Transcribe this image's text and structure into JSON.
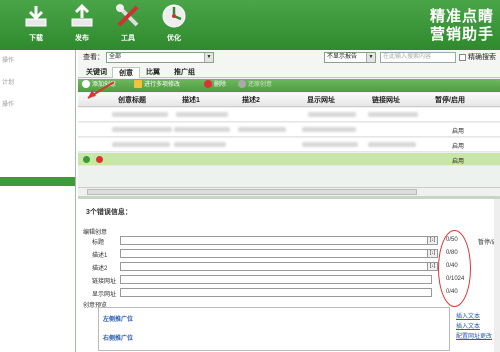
{
  "toolbar_top": {
    "buttons": [
      {
        "label": "下载",
        "icon": "download-icon"
      },
      {
        "label": "发布",
        "icon": "upload-icon"
      },
      {
        "label": "工具",
        "icon": "tools-icon"
      },
      {
        "label": "优化",
        "icon": "optimize-icon"
      }
    ],
    "brand_line1": "精准点睛",
    "brand_line2": "营销助手",
    "color": "#3a9a37"
  },
  "left_panel": {
    "items": [
      "操作",
      "计划",
      "操作"
    ]
  },
  "filter": {
    "view_label": "查看：",
    "view_select": "全部",
    "report_select": "不显示报告",
    "search_placeholder": "在此输入搜索内容",
    "exact_search_label": "精确搜索"
  },
  "tabs": [
    "关键词",
    "创意",
    "比翼",
    "推广组"
  ],
  "active_tab": "创意",
  "actions": {
    "add": "添加创意",
    "batch_edit": "进行多项修改",
    "delete": "删除",
    "restore": "还原创意"
  },
  "table": {
    "columns": [
      "创意标题",
      "描述1",
      "描述2",
      "显示网址",
      "链接网址",
      "暂停/启用"
    ],
    "rows": [
      {
        "status": ""
      },
      {
        "status": "启用"
      },
      {
        "status": "启用"
      }
    ],
    "selected_row_status": "启用"
  },
  "error_panel": {
    "title": "3个错误信息：",
    "edit_title": "编辑创意",
    "fields": [
      {
        "label": "标题",
        "count": "0/50"
      },
      {
        "label": "描述1",
        "count": "0/80"
      },
      {
        "label": "描述2",
        "count": "0/40"
      },
      {
        "label": "链接网址",
        "count": "0/1024"
      },
      {
        "label": "显示网址",
        "count": "0/40"
      }
    ],
    "field_button": "[↓]",
    "pause_label": "暂停/启",
    "preview_title": "创意预览",
    "left_ad": "左侧推广位",
    "right_ad": "右侧推广位",
    "links": [
      "插入文本",
      "插入文本",
      "配置网址更改"
    ]
  }
}
